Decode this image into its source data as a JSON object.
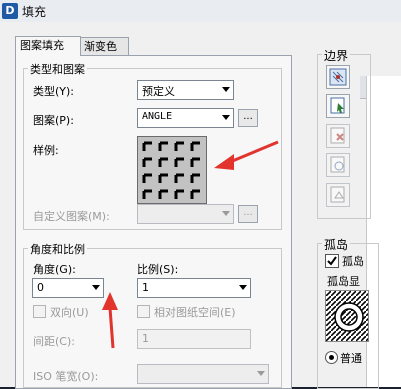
{
  "window": {
    "title": "填充"
  },
  "tabs": [
    {
      "label": "图案填充"
    },
    {
      "label": "渐变色"
    }
  ],
  "pattern_group": {
    "title": "类型和图案",
    "type_label": "类型(Y):",
    "type_value": "预定义",
    "pattern_label": "图案(P):",
    "pattern_value": "ANGLE",
    "pattern_button": "...",
    "swatch_label": "样例:",
    "custom_label": "自定义图案(M):",
    "custom_button": "..."
  },
  "angle_group": {
    "title": "角度和比例",
    "angle_label": "角度(G):",
    "angle_value": "0",
    "scale_label": "比例(S):",
    "scale_value": "1",
    "double_label": "双向(U)",
    "relative_label": "相对图纸空间(E)",
    "spacing_label": "间距(C):",
    "spacing_value": "1",
    "iso_label": "ISO 笔宽(O):"
  },
  "boundary_panel": {
    "title": "边界"
  },
  "island_panel": {
    "title": "孤岛",
    "detect_label": "孤岛",
    "display_label": "孤岛显",
    "normal_label": "普通"
  }
}
